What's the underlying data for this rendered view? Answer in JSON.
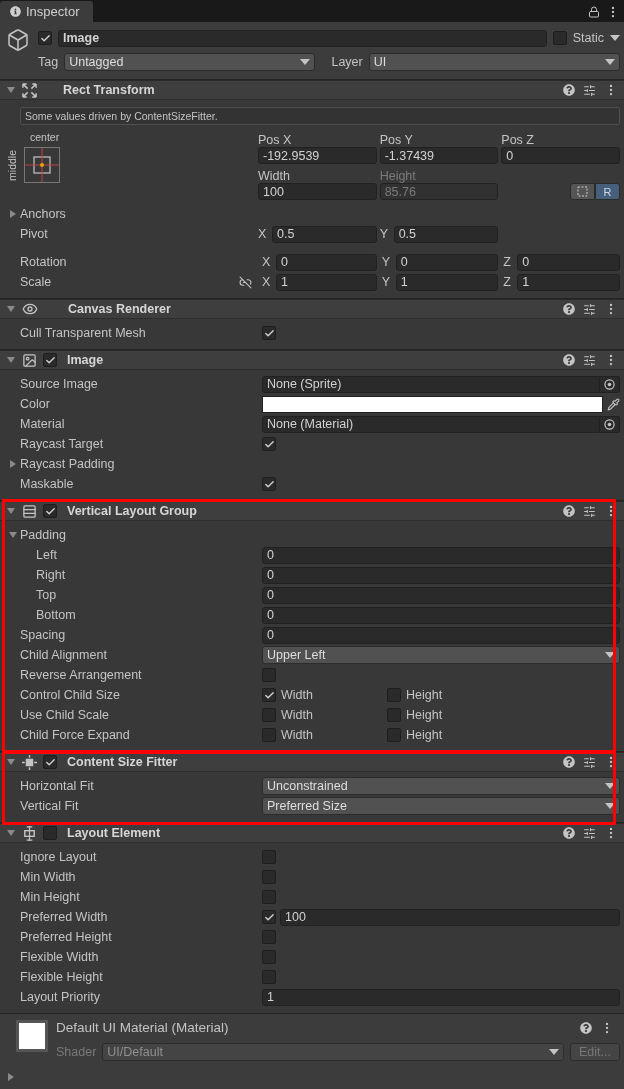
{
  "tab": {
    "label": "Inspector"
  },
  "object": {
    "active": true,
    "name": "Image",
    "static": false,
    "static_label": "Static",
    "tag_label": "Tag",
    "tag": "Untagged",
    "layer_label": "Layer",
    "layer": "UI"
  },
  "rect_transform": {
    "title": "Rect Transform",
    "expanded": true,
    "notice": "Some values driven by ContentSizeFitter.",
    "anchor_h": "center",
    "anchor_v": "middle",
    "fields": [
      {
        "label": "Pos X",
        "value": "-192.9539",
        "disabled": false
      },
      {
        "label": "Pos Y",
        "value": "-1.37439",
        "disabled": false
      },
      {
        "label": "Pos Z",
        "value": "0",
        "disabled": false
      },
      {
        "label": "Width",
        "value": "100",
        "disabled": false
      },
      {
        "label": "Height",
        "value": "85.76",
        "disabled": true
      }
    ],
    "raw_button": "R",
    "raw_selected": true,
    "anchors": {
      "label": "Anchors",
      "expanded": false
    },
    "pivot": {
      "label": "Pivot",
      "components": [
        {
          "axis": "X",
          "value": "0.5"
        },
        {
          "axis": "Y",
          "value": "0.5"
        }
      ]
    },
    "rotation": {
      "label": "Rotation",
      "components": [
        {
          "axis": "X",
          "value": "0"
        },
        {
          "axis": "Y",
          "value": "0"
        },
        {
          "axis": "Z",
          "value": "0"
        }
      ]
    },
    "scale": {
      "label": "Scale",
      "components": [
        {
          "axis": "X",
          "value": "1"
        },
        {
          "axis": "Y",
          "value": "1"
        },
        {
          "axis": "Z",
          "value": "1"
        }
      ]
    }
  },
  "components": [
    {
      "title": "Canvas Renderer",
      "kind": "eye",
      "expanded": true,
      "highlighted": false,
      "rows": [
        {
          "kind": "checkbox",
          "label": "Cull Transparent Mesh",
          "checked": true
        }
      ]
    },
    {
      "title": "Image",
      "kind": "image",
      "enabled": true,
      "expanded": true,
      "highlighted": false,
      "rows": [
        {
          "kind": "object",
          "label": "Source Image",
          "value": "None (Sprite)"
        },
        {
          "kind": "color",
          "label": "Color",
          "color": "#ffffff"
        },
        {
          "kind": "object",
          "label": "Material",
          "value": "None (Material)"
        },
        {
          "kind": "checkbox",
          "label": "Raycast Target",
          "checked": true
        },
        {
          "kind": "foldout",
          "label": "Raycast Padding",
          "expanded": false
        },
        {
          "kind": "checkbox",
          "label": "Maskable",
          "checked": true
        }
      ]
    },
    {
      "title": "Vertical Layout Group",
      "kind": "rows",
      "enabled": true,
      "expanded": true,
      "highlighted": true,
      "rows": [
        {
          "kind": "foldout",
          "label": "Padding",
          "expanded": true,
          "children": [
            {
              "kind": "field",
              "label": "Left",
              "value": "0"
            },
            {
              "kind": "field",
              "label": "Right",
              "value": "0"
            },
            {
              "kind": "field",
              "label": "Top",
              "value": "0"
            },
            {
              "kind": "field",
              "label": "Bottom",
              "value": "0"
            }
          ]
        },
        {
          "kind": "field",
          "label": "Spacing",
          "value": "0"
        },
        {
          "kind": "dropdown",
          "label": "Child Alignment",
          "value": "Upper Left"
        },
        {
          "kind": "checkbox",
          "label": "Reverse Arrangement",
          "checked": false
        },
        {
          "kind": "pair",
          "label": "Control Child Size",
          "options": [
            {
              "label": "Width",
              "checked": true
            },
            {
              "label": "Height",
              "checked": false
            }
          ]
        },
        {
          "kind": "pair",
          "label": "Use Child Scale",
          "options": [
            {
              "label": "Width",
              "checked": false
            },
            {
              "label": "Height",
              "checked": false
            }
          ]
        },
        {
          "kind": "pair",
          "label": "Child Force Expand",
          "options": [
            {
              "label": "Width",
              "checked": false
            },
            {
              "label": "Height",
              "checked": false
            }
          ]
        }
      ]
    },
    {
      "title": "Content Size Fitter",
      "kind": "fitter",
      "enabled": true,
      "expanded": true,
      "highlighted": true,
      "rows": [
        {
          "kind": "dropdown",
          "label": "Horizontal Fit",
          "value": "Unconstrained"
        },
        {
          "kind": "dropdown",
          "label": "Vertical Fit",
          "value": "Preferred Size"
        }
      ]
    },
    {
      "title": "Layout Element",
      "kind": "element",
      "enabled": false,
      "expanded": true,
      "highlighted": false,
      "rows": [
        {
          "kind": "checkbox",
          "label": "Ignore Layout",
          "checked": false
        },
        {
          "kind": "checkbox",
          "label": "Min Width",
          "checked": false
        },
        {
          "kind": "checkbox",
          "label": "Min Height",
          "checked": false
        },
        {
          "kind": "checkbox_field",
          "label": "Preferred Width",
          "checked": true,
          "value": "100"
        },
        {
          "kind": "checkbox",
          "label": "Preferred Height",
          "checked": false
        },
        {
          "kind": "checkbox",
          "label": "Flexible Width",
          "checked": false
        },
        {
          "kind": "checkbox",
          "label": "Flexible Height",
          "checked": false
        },
        {
          "kind": "field",
          "label": "Layout Priority",
          "value": "1"
        }
      ]
    }
  ],
  "material": {
    "title": "Default UI Material (Material)",
    "expanded": false,
    "shader_label": "Shader",
    "shader": "UI/Default",
    "edit_button": "Edit..."
  }
}
